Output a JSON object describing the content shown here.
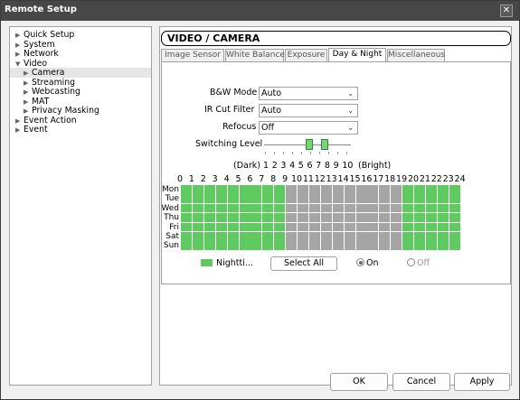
{
  "window": {
    "title": "Remote Setup",
    "close_glyph": "✕"
  },
  "tree": [
    {
      "label": "Quick Setup",
      "arrow": "▶",
      "indent": 0
    },
    {
      "label": "System",
      "arrow": "▶",
      "indent": 0
    },
    {
      "label": "Network",
      "arrow": "▶",
      "indent": 0
    },
    {
      "label": "Video",
      "arrow": "▼",
      "indent": 0
    },
    {
      "label": "Camera",
      "arrow": "▶",
      "indent": 1,
      "selected": true
    },
    {
      "label": "Streaming",
      "arrow": "▶",
      "indent": 1
    },
    {
      "label": "Webcasting",
      "arrow": "▶",
      "indent": 1
    },
    {
      "label": "MAT",
      "arrow": "▶",
      "indent": 1
    },
    {
      "label": "Privacy Masking",
      "arrow": "▶",
      "indent": 1
    },
    {
      "label": "Event Action",
      "arrow": "▶",
      "indent": 0
    },
    {
      "label": "Event",
      "arrow": "▶",
      "indent": 0
    }
  ],
  "header": {
    "title": "VIDEO / CAMERA"
  },
  "tabs": [
    "Image Sensor",
    "White Balance",
    "Exposure",
    "Day & Night",
    "Miscellaneous"
  ],
  "active_tab": "Day & Night",
  "form": {
    "bw_mode": {
      "label": "B&W Mode",
      "value": "Auto"
    },
    "ir_cut": {
      "label": "IR Cut Filter",
      "value": "Auto"
    },
    "refocus": {
      "label": "Refocus",
      "value": "Off"
    },
    "switching": {
      "label": "Switching Level"
    },
    "scale": {
      "dark": "(Dark)",
      "bright": "(Bright)",
      "numbers": [
        "1",
        "2",
        "3",
        "4",
        "5",
        "6",
        "7",
        "8",
        "9",
        "10"
      ]
    }
  },
  "schedule": {
    "hours": [
      "0",
      "1",
      "2",
      "3",
      "4",
      "5",
      "6",
      "7",
      "8",
      "9",
      "10",
      "11",
      "12",
      "13",
      "14",
      "15",
      "16",
      "17",
      "18",
      "19",
      "20",
      "21",
      "22",
      "23",
      "24"
    ],
    "days": [
      "Mon",
      "Tue",
      "Wed",
      "Thu",
      "Fri",
      "Sat",
      "Sun"
    ],
    "night_hours": [
      0,
      1,
      2,
      3,
      4,
      5,
      6,
      7,
      8,
      19,
      20,
      21,
      22,
      23
    ],
    "legend": "Nightti...",
    "select_all": "Select All",
    "on": "On",
    "off": "Off",
    "on_checked": true
  },
  "buttons": {
    "ok": "OK",
    "cancel": "Cancel",
    "apply": "Apply"
  },
  "colors": {
    "night": "#5fca5f",
    "day": "#a5a5a5",
    "titlebar": "#474747"
  }
}
